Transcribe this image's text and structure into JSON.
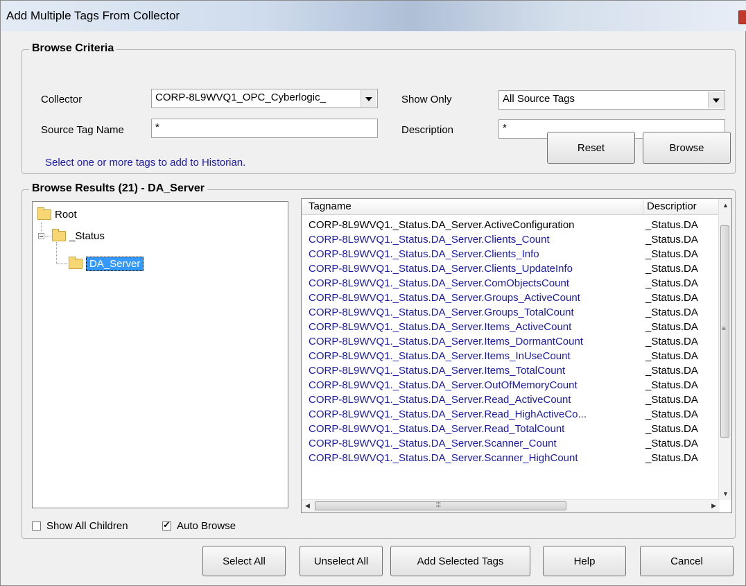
{
  "window": {
    "title": "Add Multiple Tags From Collector"
  },
  "criteria": {
    "group_title": "Browse Criteria",
    "collector_label": "Collector",
    "collector_value": "CORP-8L9WVQ1_OPC_Cyberlogic_",
    "show_only_label": "Show Only",
    "show_only_value": "All Source Tags",
    "source_tag_label": "Source Tag Name",
    "source_tag_value": "*",
    "description_label": "Description",
    "description_value": "*",
    "hint": "Select one or more tags to add to Historian.",
    "reset_label": "Reset",
    "browse_label": "Browse"
  },
  "results": {
    "group_title": "Browse Results (21) - DA_Server",
    "tree": {
      "root": "Root",
      "status": "_Status",
      "server": "DA_Server"
    },
    "show_all_children": "Show All Children",
    "auto_browse": "Auto Browse",
    "auto_browse_checked": true,
    "show_all_children_checked": false,
    "columns": [
      "Tagname",
      "Descriptior"
    ],
    "rows": [
      {
        "tag": "CORP-8L9WVQ1._Status.DA_Server.ActiveConfiguration",
        "desc": "_Status.DA"
      },
      {
        "tag": "CORP-8L9WVQ1._Status.DA_Server.Clients_Count",
        "desc": "_Status.DA"
      },
      {
        "tag": "CORP-8L9WVQ1._Status.DA_Server.Clients_Info",
        "desc": "_Status.DA"
      },
      {
        "tag": "CORP-8L9WVQ1._Status.DA_Server.Clients_UpdateInfo",
        "desc": "_Status.DA"
      },
      {
        "tag": "CORP-8L9WVQ1._Status.DA_Server.ComObjectsCount",
        "desc": "_Status.DA"
      },
      {
        "tag": "CORP-8L9WVQ1._Status.DA_Server.Groups_ActiveCount",
        "desc": "_Status.DA"
      },
      {
        "tag": "CORP-8L9WVQ1._Status.DA_Server.Groups_TotalCount",
        "desc": "_Status.DA"
      },
      {
        "tag": "CORP-8L9WVQ1._Status.DA_Server.Items_ActiveCount",
        "desc": "_Status.DA"
      },
      {
        "tag": "CORP-8L9WVQ1._Status.DA_Server.Items_DormantCount",
        "desc": "_Status.DA"
      },
      {
        "tag": "CORP-8L9WVQ1._Status.DA_Server.Items_InUseCount",
        "desc": "_Status.DA"
      },
      {
        "tag": "CORP-8L9WVQ1._Status.DA_Server.Items_TotalCount",
        "desc": "_Status.DA"
      },
      {
        "tag": "CORP-8L9WVQ1._Status.DA_Server.OutOfMemoryCount",
        "desc": "_Status.DA"
      },
      {
        "tag": "CORP-8L9WVQ1._Status.DA_Server.Read_ActiveCount",
        "desc": "_Status.DA"
      },
      {
        "tag": "CORP-8L9WVQ1._Status.DA_Server.Read_HighActiveCo...",
        "desc": "_Status.DA"
      },
      {
        "tag": "CORP-8L9WVQ1._Status.DA_Server.Read_TotalCount",
        "desc": "_Status.DA"
      },
      {
        "tag": "CORP-8L9WVQ1._Status.DA_Server.Scanner_Count",
        "desc": "_Status.DA"
      },
      {
        "tag": "CORP-8L9WVQ1._Status.DA_Server.Scanner_HighCount",
        "desc": "_Status.DA"
      }
    ]
  },
  "footer": {
    "select_all": "Select All",
    "unselect_all": "Unselect All",
    "add_selected": "Add Selected Tags",
    "help": "Help",
    "cancel": "Cancel"
  },
  "colors": {
    "link_text": "#1a1aa8",
    "selection": "#3399ff"
  }
}
